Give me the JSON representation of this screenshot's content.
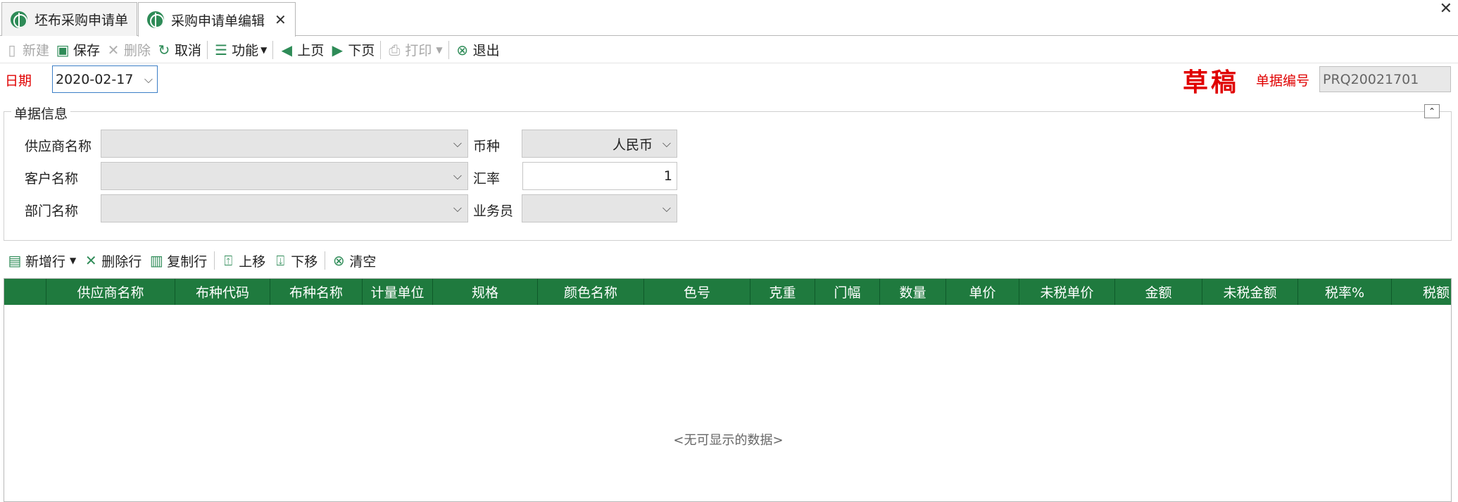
{
  "tabs": [
    {
      "label": "坯布采购申请单"
    },
    {
      "label": "采购申请单编辑"
    }
  ],
  "toolbar": {
    "new": "新建",
    "save": "保存",
    "delete": "删除",
    "cancel": "取消",
    "function": "功能",
    "prev": "上页",
    "next": "下页",
    "print": "打印",
    "exit": "退出"
  },
  "header": {
    "date_label": "日期",
    "date_value": "2020-02-17",
    "status": "草稿",
    "docno_label": "单据编号",
    "docno_value": "PRQ20021701"
  },
  "group": {
    "title": "单据信息",
    "supplier_label": "供应商名称",
    "supplier_value": "",
    "customer_label": "客户名称",
    "customer_value": "",
    "department_label": "部门名称",
    "department_value": "",
    "currency_label": "币种",
    "currency_value": "人民币",
    "rate_label": "汇率",
    "rate_value": "1",
    "salesman_label": "业务员",
    "salesman_value": ""
  },
  "grid_toolbar": {
    "add_row": "新增行",
    "delete_row": "删除行",
    "copy_row": "复制行",
    "move_up": "上移",
    "move_down": "下移",
    "clear": "清空"
  },
  "grid": {
    "columns": [
      "",
      "供应商名称",
      "布种代码",
      "布种名称",
      "计量单位",
      "规格",
      "颜色名称",
      "色号",
      "克重",
      "门幅",
      "数量",
      "单价",
      "未税单价",
      "金额",
      "未税金额",
      "税率%",
      "税额"
    ],
    "empty_text": "<无可显示的数据>"
  },
  "colors": {
    "header_green": "#1f7a3e",
    "red_label": "#e00000"
  }
}
